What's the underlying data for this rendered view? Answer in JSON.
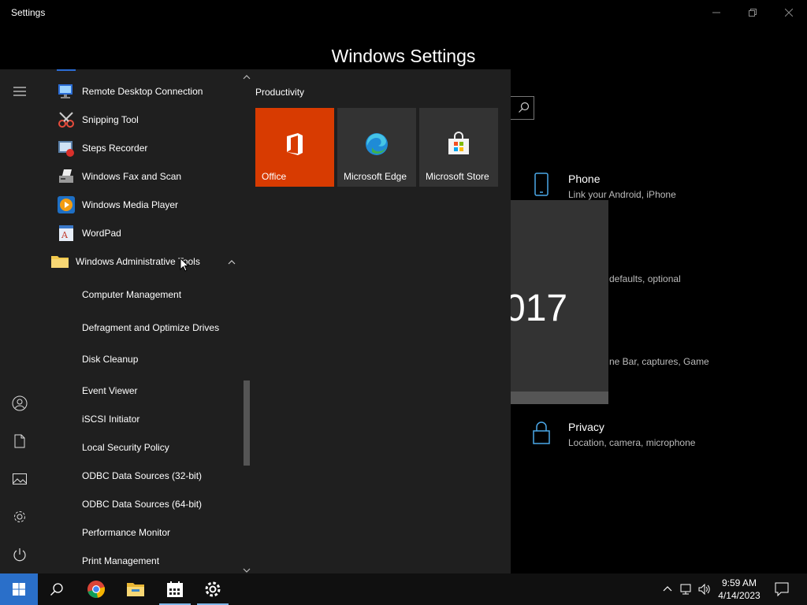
{
  "window": {
    "title": "Settings",
    "heading": "Windows Settings"
  },
  "settings_items": {
    "phone": {
      "title": "Phone",
      "desc": "Link your Android, iPhone"
    },
    "privacy": {
      "title": "Privacy",
      "desc": "Location, camera, microphone"
    },
    "apps_partial": "defaults, optional",
    "gaming_partial": "ne Bar, captures, Game",
    "big_number_partial": "017"
  },
  "start_menu": {
    "apps": [
      {
        "label": "Remote Desktop Connection",
        "icon": "remote-desktop-icon"
      },
      {
        "label": "Snipping Tool",
        "icon": "snipping-tool-icon"
      },
      {
        "label": "Steps Recorder",
        "icon": "steps-recorder-icon"
      },
      {
        "label": "Windows Fax and Scan",
        "icon": "fax-scan-icon"
      },
      {
        "label": "Windows Media Player",
        "icon": "media-player-icon"
      },
      {
        "label": "WordPad",
        "icon": "wordpad-icon"
      }
    ],
    "folder": {
      "label": "Windows Administrative Tools",
      "icon": "folder-icon"
    },
    "admin_tools": [
      "Computer Management",
      "Defragment and Optimize Drives",
      "Disk Cleanup",
      "Event Viewer",
      "iSCSI Initiator",
      "Local Security Policy",
      "ODBC Data Sources (32-bit)",
      "ODBC Data Sources (64-bit)",
      "Performance Monitor",
      "Print Management"
    ],
    "group_title": "Productivity",
    "tiles": [
      {
        "label": "Office",
        "color": "#d83b01",
        "icon": "office-icon"
      },
      {
        "label": "Microsoft Edge",
        "color": "#333333",
        "icon": "edge-icon"
      },
      {
        "label": "Microsoft Store",
        "color": "#333333",
        "icon": "store-icon"
      }
    ]
  },
  "taskbar": {
    "time": "9:59 AM",
    "date": "4/14/2023"
  },
  "colors": {
    "accent": "#2a6fc9",
    "office": "#d83b01"
  }
}
